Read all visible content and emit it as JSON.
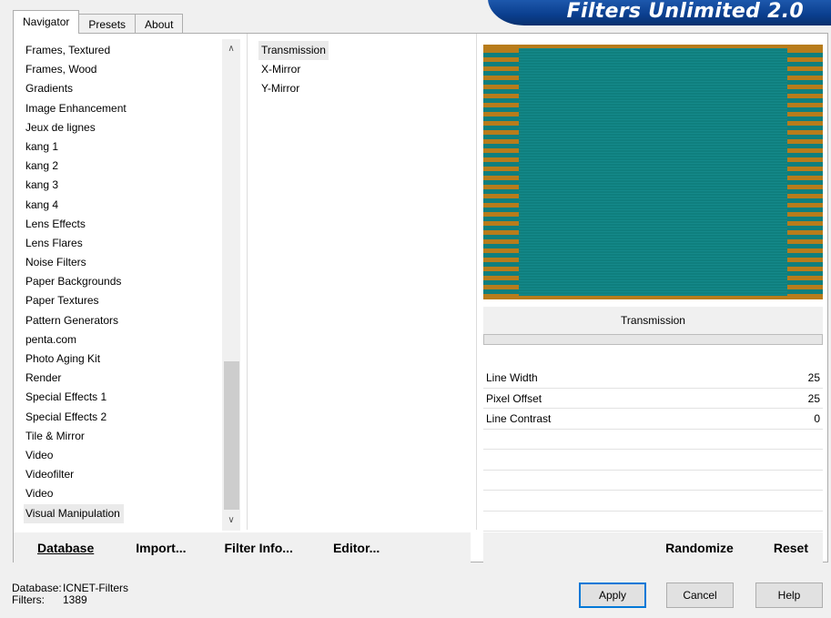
{
  "tabs": [
    "Navigator",
    "Presets",
    "About"
  ],
  "logo_text": "Filters Unlimited 2.0",
  "categories": [
    "Frames, Textured",
    "Frames, Wood",
    "Gradients",
    "Image Enhancement",
    "Jeux de lignes",
    "kang 1",
    "kang 2",
    "kang 3",
    "kang 4",
    "Lens Effects",
    "Lens Flares",
    "Noise Filters",
    "Paper Backgrounds",
    "Paper Textures",
    "Pattern Generators",
    "penta.com",
    "Photo Aging Kit",
    "Render",
    "Special Effects 1",
    "Special Effects 2",
    "Tile & Mirror",
    "Video",
    "Videofilter",
    "Video",
    "Visual Manipulation"
  ],
  "selected_category": "Visual Manipulation",
  "filters": [
    "Transmission",
    "X-Mirror",
    "Y-Mirror"
  ],
  "selected_filter": "Transmission",
  "filter_name": "Transmission",
  "params": [
    {
      "label": "Line Width",
      "value": "25"
    },
    {
      "label": "Pixel Offset",
      "value": "25"
    },
    {
      "label": "Line Contrast",
      "value": "0"
    }
  ],
  "buttons_left": [
    "Database",
    "Import...",
    "Filter Info...",
    "Editor..."
  ],
  "buttons_right": [
    "Randomize",
    "Reset"
  ],
  "footer": {
    "database_label": "Database:",
    "database_value": "ICNET-Filters",
    "filters_label": "Filters:",
    "filters_value": "1389"
  },
  "dialog_buttons": {
    "apply": "Apply",
    "cancel": "Cancel",
    "help": "Help"
  },
  "colors": {
    "preview_teal": "#0f7f7e",
    "preview_orange": "#b87c1b",
    "accent": "#0078d7"
  }
}
